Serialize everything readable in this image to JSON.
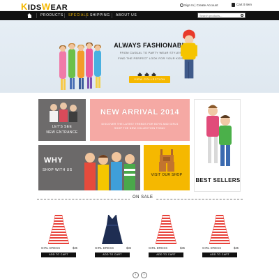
{
  "header": {
    "logo_first": "K",
    "logo_rest": "IDS",
    "logo_accent": "W",
    "logo_end": "EAR",
    "account": "Sign In | Create Account",
    "cart": "Cart 0 item"
  },
  "nav": {
    "items": [
      {
        "label": "PRODUCTS",
        "active": false
      },
      {
        "label": "SPECIALS",
        "active": true
      },
      {
        "label": "SHIPPING",
        "active": false
      },
      {
        "label": "ABOUT US",
        "active": false
      }
    ],
    "search_placeholder": "Search products..."
  },
  "hero": {
    "title": "ALWAYS FASHIONABLE",
    "line1": "FROM CASUAL TO PARTY WEAR STYLES",
    "line2": "FIND THE PERFECT LOOK FOR YOUR KIDS",
    "button": "VIEW COLLECTION"
  },
  "tiles": {
    "new_line1": "LET'S SEE",
    "new_line2": "NEW ENTRANCE",
    "arrival_title": "NEW ARRIVAL 2014",
    "arrival_line1": "DISCOVER THE LATEST TRENDS FOR BOYS AND GIRLS",
    "arrival_line2": "SHOP THE NEW COLLECTION TODAY",
    "best_sellers": "BEST SELLERS",
    "why_title": "WHY",
    "why_sub": "SHOP WITH US",
    "visit_label": "VISIT OUR SHOP"
  },
  "section": {
    "label": "ON SALE"
  },
  "products": [
    {
      "name": "GIRL DRESS",
      "price": "$35",
      "button": "ADD TO CART",
      "style": "stripe"
    },
    {
      "name": "GIRL DRESS",
      "price": "$35",
      "button": "ADD TO CART",
      "style": "navy"
    },
    {
      "name": "GIRL DRESS",
      "price": "$35",
      "button": "ADD TO CART",
      "style": "stripe"
    },
    {
      "name": "GIRL DRESS",
      "price": "$35",
      "button": "ADD TO CART",
      "style": "stripe"
    }
  ],
  "carousel": {
    "prev": "‹",
    "next": "›"
  },
  "colors": {
    "accent": "#f5b800",
    "dark": "#111111",
    "pink": "#f5a9a4",
    "grey": "#6b6969"
  }
}
